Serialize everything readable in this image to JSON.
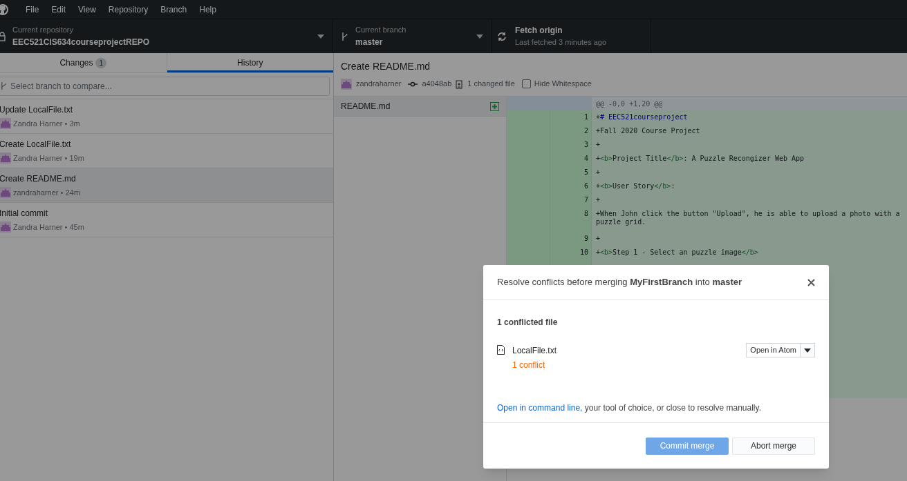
{
  "menu": [
    "File",
    "Edit",
    "View",
    "Repository",
    "Branch",
    "Help"
  ],
  "toolbar": {
    "repository": {
      "label": "Current repository",
      "value": "EEC521CIS634courseprojectREPO"
    },
    "branch": {
      "label": "Current branch",
      "value": "master"
    },
    "fetch": {
      "label": "Fetch origin",
      "value": "Last fetched 3 minutes ago"
    }
  },
  "tabs": [
    {
      "label": "Changes",
      "count": "1",
      "selected": false
    },
    {
      "label": "History",
      "selected": true
    }
  ],
  "branch_filter": {
    "placeholder": "Select branch to compare..."
  },
  "commits": [
    {
      "title": "Update LocalFile.txt",
      "meta": "Zandra Harner • 3m",
      "selected": false
    },
    {
      "title": "Create LocalFile.txt",
      "meta": "Zandra Harner • 19m",
      "selected": false
    },
    {
      "title": "Create README.md",
      "meta": "zandraharner • 24m",
      "selected": true
    },
    {
      "title": "Initial commit",
      "meta": "Zandra Harner • 45m",
      "selected": false
    }
  ],
  "commit_detail": {
    "title": "Create README.md",
    "author": "zandraharner",
    "sha": "a4048ab",
    "changed": "1 changed file",
    "hide_whitespace": {
      "label": "Hide Whitespace",
      "checked": false
    }
  },
  "files": [
    {
      "name": "README.md",
      "selected": true
    }
  ],
  "diff": {
    "hunk": "@@ -0,0 +1,20 @@",
    "lines": [
      {
        "num": "1",
        "kind": "heading",
        "prefix": "+",
        "text": "# EEC521courseproject"
      },
      {
        "num": "2",
        "kind": "plain",
        "prefix": "+",
        "text": "Fall 2020 Course Project"
      },
      {
        "num": "3",
        "kind": "plain",
        "prefix": "+"
      },
      {
        "num": "4",
        "kind": "tagged",
        "prefix": "+",
        "open": "<b>",
        "text": "Project Title",
        "close": "</b>",
        "rest": ": A Puzzle Recongizer Web App"
      },
      {
        "num": "5",
        "kind": "plain",
        "prefix": "+"
      },
      {
        "num": "6",
        "kind": "tagged",
        "prefix": "+",
        "open": "<b>",
        "text": "User Story",
        "close": "</b>",
        "rest": ":"
      },
      {
        "num": "7",
        "kind": "plain",
        "prefix": "+"
      },
      {
        "num": "8",
        "kind": "plain",
        "prefix": "+",
        "text": "When John click the button \"Upload\", he is able to upload a photo with a",
        "wrap": "puzzle grid."
      },
      {
        "num": "9",
        "kind": "plain",
        "prefix": "+"
      },
      {
        "num": "10",
        "kind": "tagged",
        "prefix": "+",
        "open": "<b>",
        "text": "Step 1 - Select an puzzle image",
        "close": "</b>"
      }
    ]
  },
  "dialog": {
    "title": "Resolve conflicts before merging **MyFirstBranch** into **master**",
    "count": "1 conflicted file",
    "files": [
      {
        "name": "LocalFile.txt",
        "status": "1 conflict",
        "action": "Open in Atom"
      }
    ],
    "link": "Open in command line,",
    "hint": " your tool of choice, or close to resolve manually.",
    "primary": {
      "label": "Commit merge",
      "disabled": true
    },
    "secondary": "Abort merge"
  }
}
